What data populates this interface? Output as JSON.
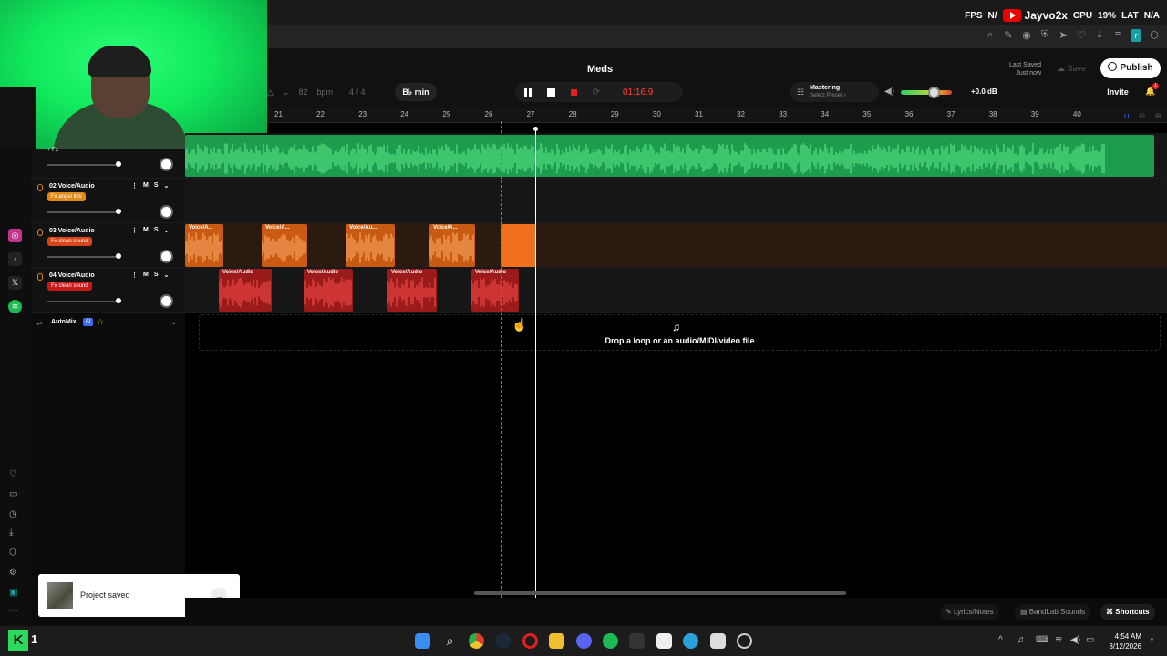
{
  "overlay": {
    "fps_label": "FPS",
    "fps_value": "N/",
    "channel": "Jayvo2x",
    "cpu_label": "CPU",
    "cpu_value": "19%",
    "lat_label": "LAT",
    "lat_value": "N/A"
  },
  "studio": {
    "project_title": "Meds",
    "last_saved_label": "Last Saved",
    "last_saved_value": "Just now",
    "save_label": "Save",
    "publish_label": "Publish",
    "invite_label": "Invite",
    "notification_count": "1",
    "bpm_value": "82",
    "bpm_label": "bpm",
    "time_signature": "4 / 4",
    "key": "B♭ min",
    "time_display": "01:16.9",
    "mastering_title": "Mastering",
    "mastering_sub": "Select Preset ›",
    "volume_db": "+0.0 dB",
    "volume_level": 0.65
  },
  "ruler": {
    "bars": [
      "21",
      "22",
      "23",
      "24",
      "25",
      "26",
      "27",
      "28",
      "29",
      "30",
      "31",
      "32",
      "33",
      "34",
      "35",
      "36",
      "37",
      "38",
      "39",
      "40"
    ]
  },
  "tracks": [
    {
      "number": "02",
      "name": "Voice/Audio",
      "fx": "Fx angel libs",
      "fx_color": "#e08a1a",
      "mute": "M",
      "solo": "S"
    },
    {
      "number": "03",
      "name": "Voice/Audio",
      "fx": "Fx clean sound",
      "fx_color": "#d8461a",
      "mute": "M",
      "solo": "S"
    },
    {
      "number": "04",
      "name": "Voice/Audio",
      "fx": "Fx clean sound",
      "fx_color": "#c81a1a",
      "mute": "M",
      "solo": "S"
    }
  ],
  "top_track_fx": "+ Fx",
  "clips": {
    "orange": [
      "Voice/A...",
      "Voice/A...",
      "Voice/Au...",
      "Voice/A..."
    ],
    "red": [
      "Voice/Audio",
      "Voice/Audio",
      "Voice/Audio",
      "Voice/Audio"
    ]
  },
  "automix": {
    "label": "AutoMix",
    "badge": "AI"
  },
  "drop_zone": {
    "text": "Drop a loop or an audio/MIDI/video file"
  },
  "toast": {
    "message": "Project saved"
  },
  "bottom_bar": {
    "lyrics": "Lyrics/Notes",
    "sounds": "BandLab Sounds",
    "shortcuts": "Shortcuts"
  },
  "taskbar": {
    "time": "4:54 AM",
    "date": "3/12/2026",
    "logo_text": "K",
    "logo_num": "1"
  },
  "colors": {
    "green_clip": "#1d9b4f",
    "orange_clip": "#c85a12",
    "red_clip": "#9b1a1a",
    "accent": "#3b6cf0",
    "time_red": "#ff4040"
  }
}
